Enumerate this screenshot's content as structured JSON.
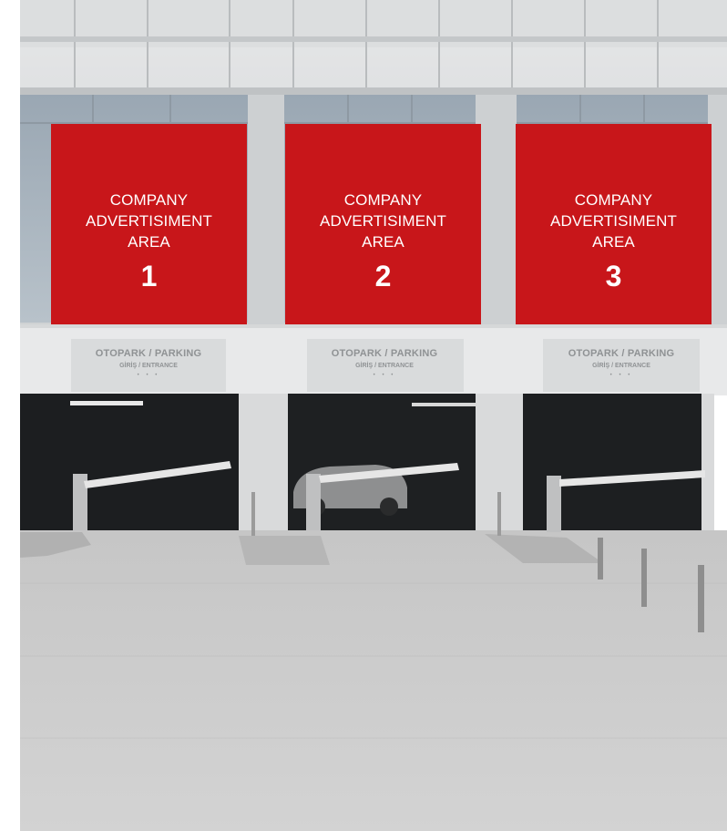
{
  "ads": [
    {
      "line1": "COMPANY",
      "line2": "ADVERTISIMENT",
      "line3": "AREA",
      "number": "1"
    },
    {
      "line1": "COMPANY",
      "line2": "ADVERTISIMENT",
      "line3": "AREA",
      "number": "2"
    },
    {
      "line1": "COMPANY",
      "line2": "ADVERTISIMENT",
      "line3": "AREA",
      "number": "3"
    }
  ],
  "signs": [
    {
      "title": "OTOPARK / PARKING",
      "subtitle": "GİRİŞ / ENTRANCE",
      "dots": "• • •"
    },
    {
      "title": "OTOPARK / PARKING",
      "subtitle": "GİRİŞ / ENTRANCE",
      "dots": "• • •"
    },
    {
      "title": "OTOPARK / PARKING",
      "subtitle": "GİRİŞ / ENTRANCE",
      "dots": "• • •"
    }
  ],
  "colors": {
    "ad_red": "#c8161a",
    "building": "#cfd1d2",
    "pavement": "#cbcbcb",
    "garage_dark": "#1c1e20"
  }
}
